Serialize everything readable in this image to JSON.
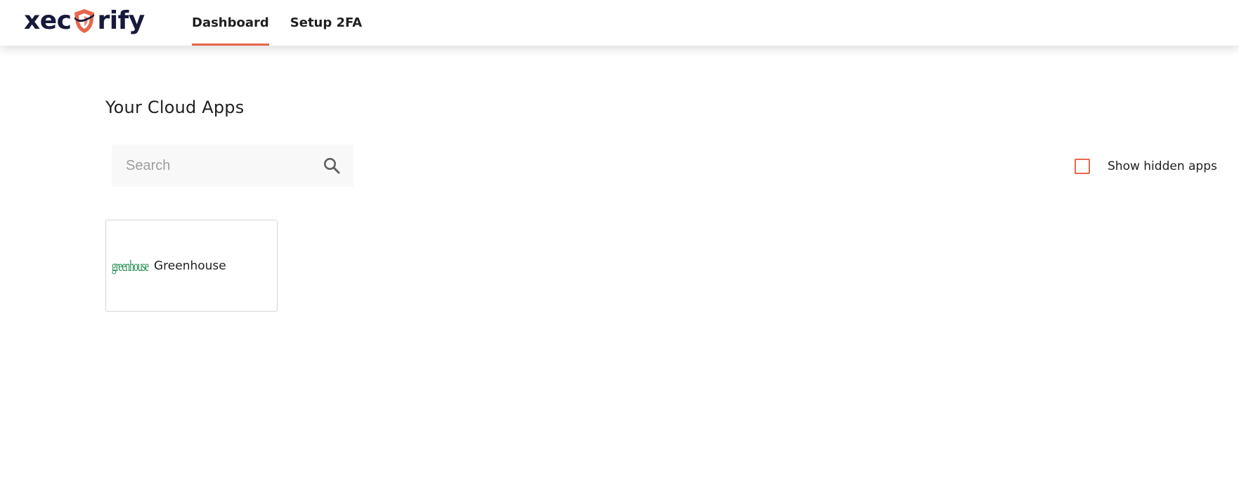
{
  "brand": {
    "logo_prefix": "xec",
    "logo_suffix": "rify",
    "logo_alt": "xecurify",
    "accent_color": "#e8664b",
    "logo_color": "#171a3b"
  },
  "nav": {
    "tabs": [
      {
        "label": "Dashboard",
        "active": true
      },
      {
        "label": "Setup 2FA",
        "active": false
      }
    ]
  },
  "main": {
    "title": "Your Cloud Apps",
    "search": {
      "placeholder": "Search",
      "value": "",
      "icon": "search-icon"
    },
    "show_hidden": {
      "label": "Show hidden apps",
      "checked": false
    },
    "apps": [
      {
        "name": "Greenhouse",
        "logo_text": "greenhouse",
        "logo_color": "#1f8a4c"
      }
    ]
  }
}
